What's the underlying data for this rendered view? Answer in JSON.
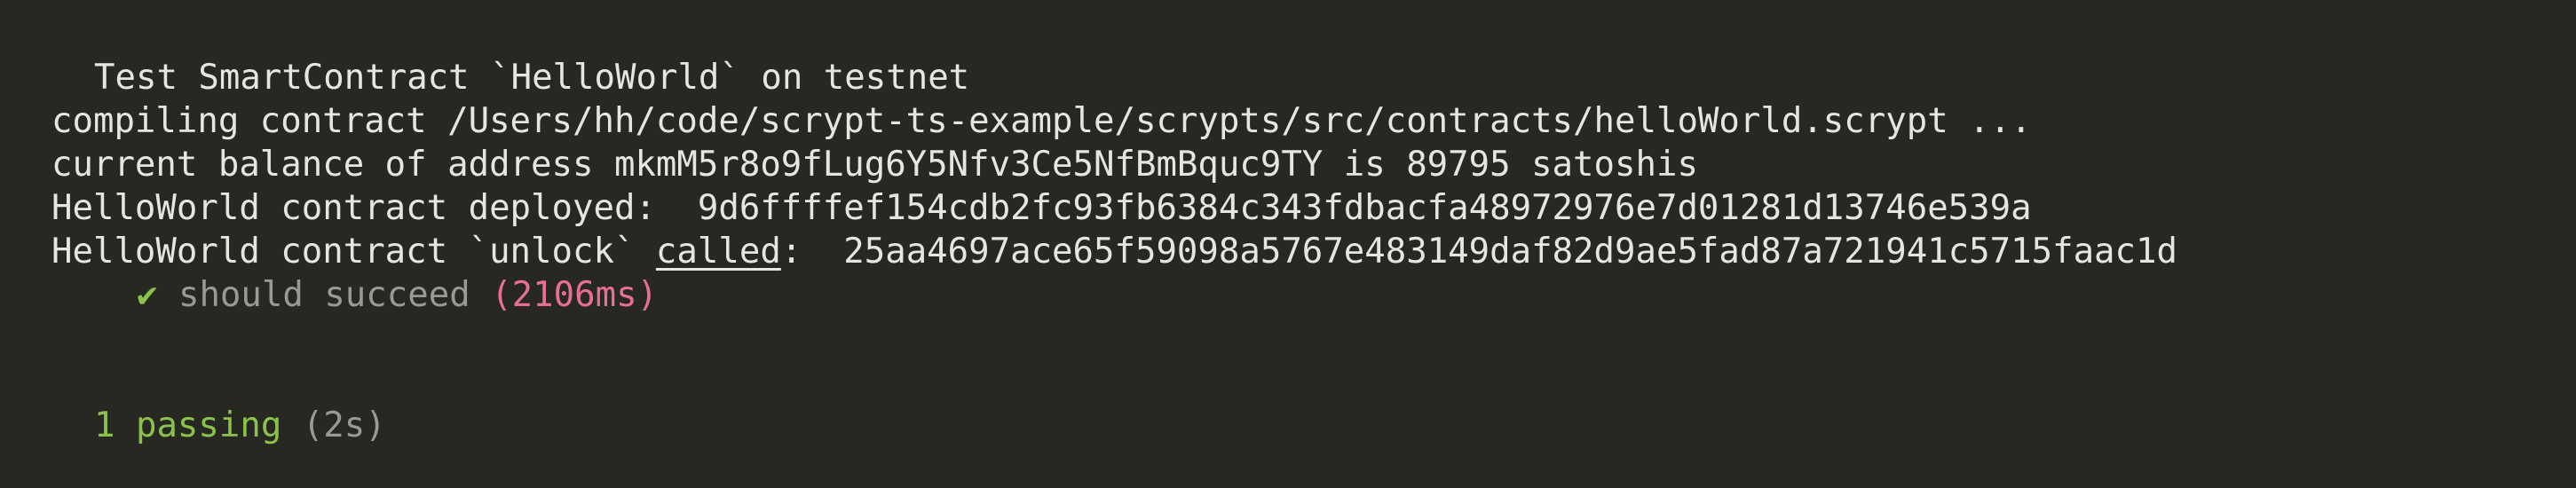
{
  "terminal": {
    "suite_title": "Test SmartContract `HelloWorld` on testnet",
    "log_lines": [
      "compiling contract /Users/hh/code/scrypt-ts-example/scrypts/src/contracts/helloWorld.scrypt ...",
      "current balance of address mkmM5r8o9fLug6Y5Nfv3Ce5NfBmBquc9TY is 89795 satoshis",
      "HelloWorld contract deployed:  9d6ffffef154cdb2fc93fb6384c343fdbacfa48972976e7d01281d13746e539a"
    ],
    "unlock_line": {
      "prefix": "HelloWorld contract `unlock` ",
      "underlined": "called",
      "suffix": ":  25aa4697ace65f59098a5767e483149daf82d9ae5fad87a721941c5715faac1d"
    },
    "test_result": {
      "check_mark": "✔",
      "name": "should succeed",
      "duration": "(2106ms)"
    },
    "summary": {
      "passing": "1 passing",
      "time": "(2s)"
    }
  },
  "colors": {
    "background": "#272822",
    "text": "#e6e6e0",
    "pass": "#8bc34a",
    "muted": "#9a9a94",
    "slow": "#e76f94"
  }
}
